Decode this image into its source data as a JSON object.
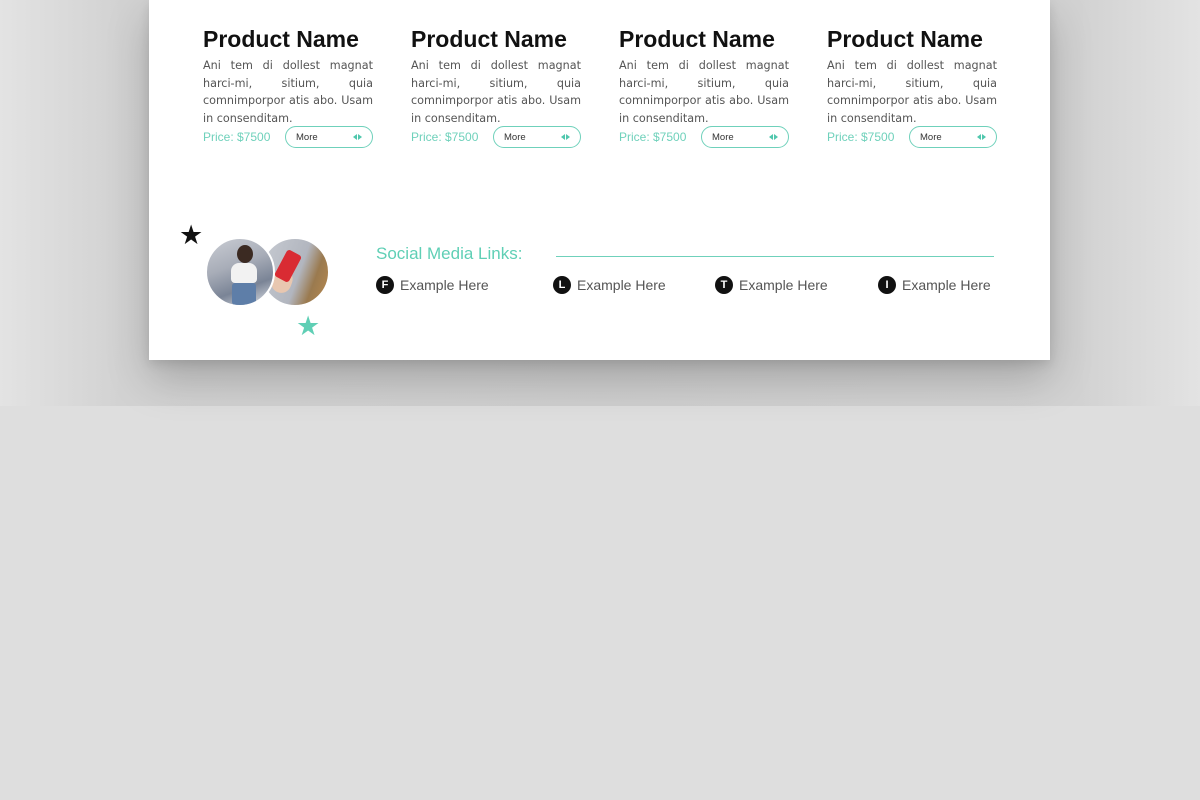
{
  "products": [
    {
      "name": "Product Name",
      "description": "Ani tem di dollest magnat harci-mi, sitium, quia comnimporpor atis abo. Usam in consenditam.",
      "price": "Price: $7500",
      "button_label": "More"
    },
    {
      "name": "Product Name",
      "description": "Ani tem di dollest magnat harci-mi, sitium, quia comnimporpor atis abo. Usam in consenditam.",
      "price": "Price: $7500",
      "button_label": "More"
    },
    {
      "name": "Product Name",
      "description": "Ani tem di dollest magnat harci-mi, sitium, quia comnimporpor atis abo. Usam in consenditam.",
      "price": "Price: $7500",
      "button_label": "More"
    },
    {
      "name": "Product Name",
      "description": "Ani tem di dollest magnat harci-mi, sitium, quia comnimporpor atis abo. Usam in consenditam.",
      "price": "Price: $7500",
      "button_label": "More"
    }
  ],
  "social": {
    "title": "Social Media Links:",
    "links": [
      {
        "badge": "F",
        "text": "Example Here",
        "icon": "facebook-icon"
      },
      {
        "badge": "L",
        "text": "Example Here",
        "icon": "linkedin-icon"
      },
      {
        "badge": "T",
        "text": "Example Here",
        "icon": "twitter-icon"
      },
      {
        "badge": "I",
        "text": "Example Here",
        "icon": "instagram-icon"
      }
    ]
  },
  "colors": {
    "accent": "#5fcfb5",
    "background": "#dedede",
    "page": "#ffffff",
    "text_dark": "#111111"
  },
  "icons": {
    "decor_star_1": "star-icon",
    "decor_star_2": "star-icon",
    "more_arrows": "arrows-left-right-icon"
  }
}
